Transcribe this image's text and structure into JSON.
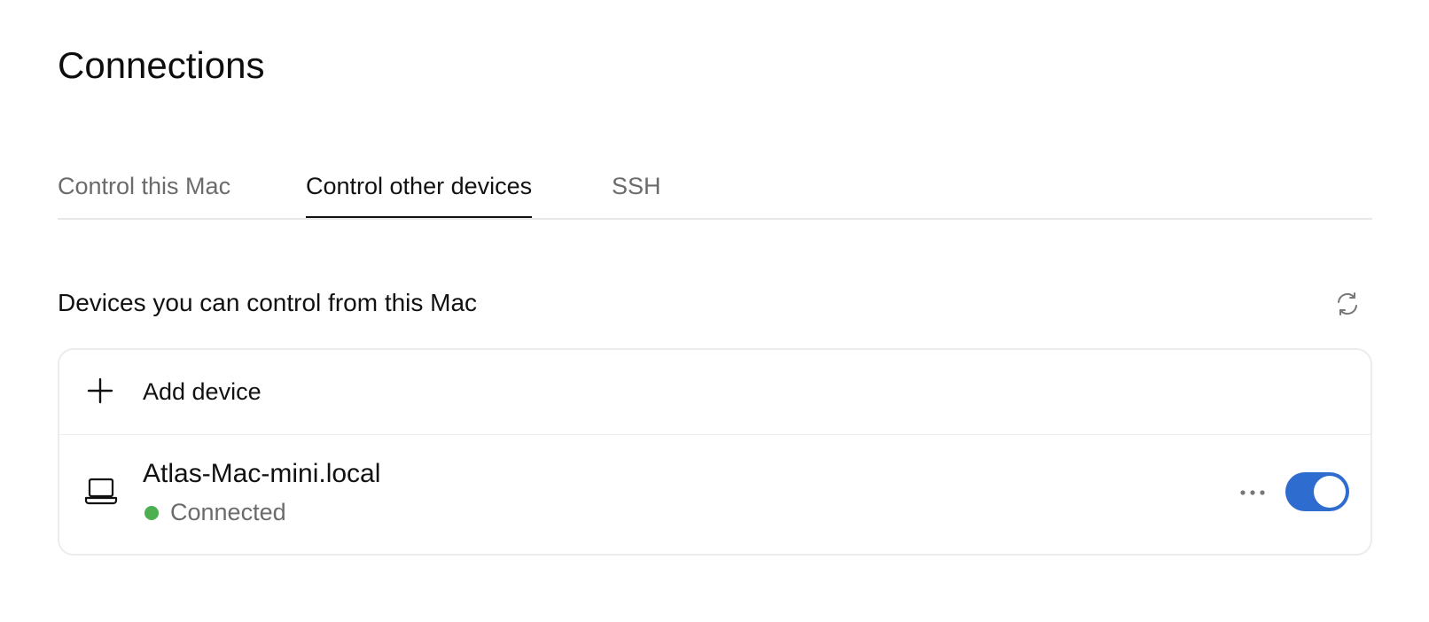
{
  "page": {
    "title": "Connections"
  },
  "tabs": [
    {
      "label": "Control this Mac",
      "active": false
    },
    {
      "label": "Control other devices",
      "active": true
    },
    {
      "label": "SSH",
      "active": false
    }
  ],
  "section": {
    "title": "Devices you can control from this Mac",
    "refresh_icon": "refresh-icon"
  },
  "add_device": {
    "label": "Add device",
    "icon": "plus-icon"
  },
  "devices": [
    {
      "name": "Atlas-Mac-mini.local",
      "status": "Connected",
      "status_color": "#4caf50",
      "icon": "laptop-icon",
      "enabled": true
    }
  ],
  "colors": {
    "accent": "#2f6ccf",
    "status_connected": "#4caf50"
  }
}
